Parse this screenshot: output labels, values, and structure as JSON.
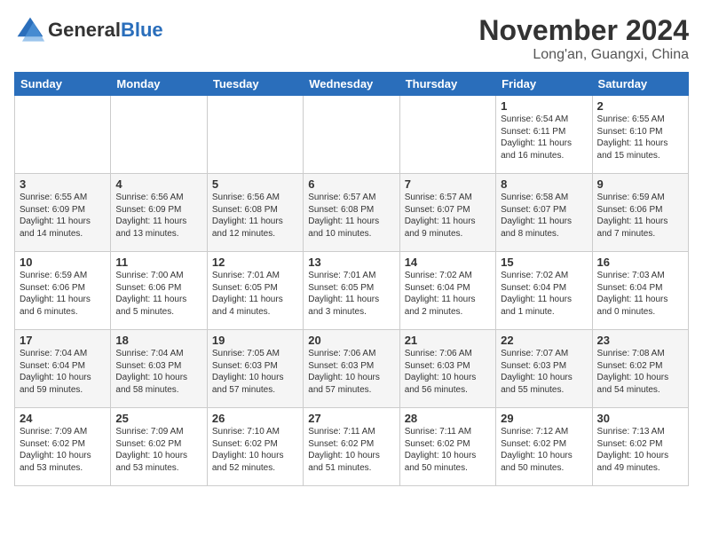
{
  "header": {
    "logo_general": "General",
    "logo_blue": "Blue",
    "month_title": "November 2024",
    "location": "Long'an, Guangxi, China"
  },
  "days_of_week": [
    "Sunday",
    "Monday",
    "Tuesday",
    "Wednesday",
    "Thursday",
    "Friday",
    "Saturday"
  ],
  "weeks": [
    [
      {
        "day": "",
        "info": ""
      },
      {
        "day": "",
        "info": ""
      },
      {
        "day": "",
        "info": ""
      },
      {
        "day": "",
        "info": ""
      },
      {
        "day": "",
        "info": ""
      },
      {
        "day": "1",
        "info": "Sunrise: 6:54 AM\nSunset: 6:11 PM\nDaylight: 11 hours and 16 minutes."
      },
      {
        "day": "2",
        "info": "Sunrise: 6:55 AM\nSunset: 6:10 PM\nDaylight: 11 hours and 15 minutes."
      }
    ],
    [
      {
        "day": "3",
        "info": "Sunrise: 6:55 AM\nSunset: 6:09 PM\nDaylight: 11 hours and 14 minutes."
      },
      {
        "day": "4",
        "info": "Sunrise: 6:56 AM\nSunset: 6:09 PM\nDaylight: 11 hours and 13 minutes."
      },
      {
        "day": "5",
        "info": "Sunrise: 6:56 AM\nSunset: 6:08 PM\nDaylight: 11 hours and 12 minutes."
      },
      {
        "day": "6",
        "info": "Sunrise: 6:57 AM\nSunset: 6:08 PM\nDaylight: 11 hours and 10 minutes."
      },
      {
        "day": "7",
        "info": "Sunrise: 6:57 AM\nSunset: 6:07 PM\nDaylight: 11 hours and 9 minutes."
      },
      {
        "day": "8",
        "info": "Sunrise: 6:58 AM\nSunset: 6:07 PM\nDaylight: 11 hours and 8 minutes."
      },
      {
        "day": "9",
        "info": "Sunrise: 6:59 AM\nSunset: 6:06 PM\nDaylight: 11 hours and 7 minutes."
      }
    ],
    [
      {
        "day": "10",
        "info": "Sunrise: 6:59 AM\nSunset: 6:06 PM\nDaylight: 11 hours and 6 minutes."
      },
      {
        "day": "11",
        "info": "Sunrise: 7:00 AM\nSunset: 6:06 PM\nDaylight: 11 hours and 5 minutes."
      },
      {
        "day": "12",
        "info": "Sunrise: 7:01 AM\nSunset: 6:05 PM\nDaylight: 11 hours and 4 minutes."
      },
      {
        "day": "13",
        "info": "Sunrise: 7:01 AM\nSunset: 6:05 PM\nDaylight: 11 hours and 3 minutes."
      },
      {
        "day": "14",
        "info": "Sunrise: 7:02 AM\nSunset: 6:04 PM\nDaylight: 11 hours and 2 minutes."
      },
      {
        "day": "15",
        "info": "Sunrise: 7:02 AM\nSunset: 6:04 PM\nDaylight: 11 hours and 1 minute."
      },
      {
        "day": "16",
        "info": "Sunrise: 7:03 AM\nSunset: 6:04 PM\nDaylight: 11 hours and 0 minutes."
      }
    ],
    [
      {
        "day": "17",
        "info": "Sunrise: 7:04 AM\nSunset: 6:04 PM\nDaylight: 10 hours and 59 minutes."
      },
      {
        "day": "18",
        "info": "Sunrise: 7:04 AM\nSunset: 6:03 PM\nDaylight: 10 hours and 58 minutes."
      },
      {
        "day": "19",
        "info": "Sunrise: 7:05 AM\nSunset: 6:03 PM\nDaylight: 10 hours and 57 minutes."
      },
      {
        "day": "20",
        "info": "Sunrise: 7:06 AM\nSunset: 6:03 PM\nDaylight: 10 hours and 57 minutes."
      },
      {
        "day": "21",
        "info": "Sunrise: 7:06 AM\nSunset: 6:03 PM\nDaylight: 10 hours and 56 minutes."
      },
      {
        "day": "22",
        "info": "Sunrise: 7:07 AM\nSunset: 6:03 PM\nDaylight: 10 hours and 55 minutes."
      },
      {
        "day": "23",
        "info": "Sunrise: 7:08 AM\nSunset: 6:02 PM\nDaylight: 10 hours and 54 minutes."
      }
    ],
    [
      {
        "day": "24",
        "info": "Sunrise: 7:09 AM\nSunset: 6:02 PM\nDaylight: 10 hours and 53 minutes."
      },
      {
        "day": "25",
        "info": "Sunrise: 7:09 AM\nSunset: 6:02 PM\nDaylight: 10 hours and 53 minutes."
      },
      {
        "day": "26",
        "info": "Sunrise: 7:10 AM\nSunset: 6:02 PM\nDaylight: 10 hours and 52 minutes."
      },
      {
        "day": "27",
        "info": "Sunrise: 7:11 AM\nSunset: 6:02 PM\nDaylight: 10 hours and 51 minutes."
      },
      {
        "day": "28",
        "info": "Sunrise: 7:11 AM\nSunset: 6:02 PM\nDaylight: 10 hours and 50 minutes."
      },
      {
        "day": "29",
        "info": "Sunrise: 7:12 AM\nSunset: 6:02 PM\nDaylight: 10 hours and 50 minutes."
      },
      {
        "day": "30",
        "info": "Sunrise: 7:13 AM\nSunset: 6:02 PM\nDaylight: 10 hours and 49 minutes."
      }
    ]
  ]
}
